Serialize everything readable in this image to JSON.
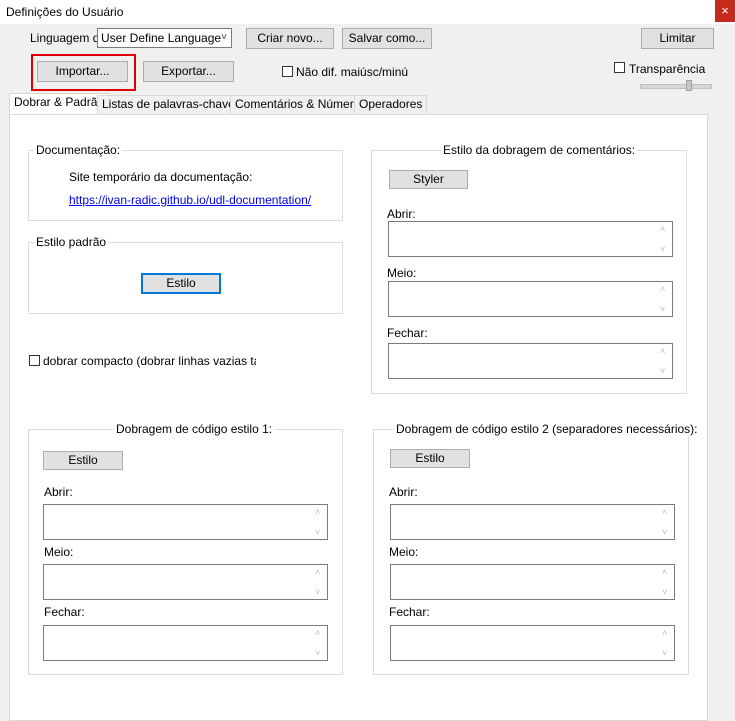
{
  "window": {
    "title": "Definições do Usuário",
    "close": "×"
  },
  "toolbar": {
    "language_label": "Linguagem do",
    "language_value": "User Define Language",
    "create_new": "Criar novo...",
    "save_as": "Salvar como...",
    "dock": "Limitar",
    "import": "Importar...",
    "export": "Exportar...",
    "ignore_case": "Não dif. maiúsc/minú",
    "transparency": "Transparência"
  },
  "tabs": [
    {
      "label": "Dobrar & Padrão",
      "active": true
    },
    {
      "label": "Listas de palavras-chave",
      "active": false
    },
    {
      "label": "Comentários & Números",
      "active": false
    },
    {
      "label": "Operadores",
      "active": false
    }
  ],
  "documentation": {
    "title": "Documentação:",
    "temp_site": "Site temporário da documentação:",
    "url": "https://ivan-radic.github.io/udl-documentation/"
  },
  "default_style": {
    "title": "Estilo padrão",
    "button": "Estilo"
  },
  "compact_fold": "dobrar compacto (dobrar linhas vazias tambe",
  "comment_fold": {
    "title": "Estilo da dobragem de comentários:",
    "button": "Styler",
    "open": "Abrir:",
    "middle": "Meio:",
    "close": "Fechar:"
  },
  "code_fold1": {
    "title": "Dobragem de código estilo 1:",
    "button": "Estilo",
    "open": "Abrir:",
    "middle": "Meio:",
    "close": "Fechar:"
  },
  "code_fold2": {
    "title": "Dobragem de código estilo 2 (separadores necessários):",
    "button": "Estilo",
    "open": "Abrir:",
    "middle": "Meio:",
    "close": "Fechar:"
  },
  "colors": {
    "highlight": "#e00000",
    "link": "#0000ee",
    "close_bg": "#c42b1c",
    "focus": "#0078d7"
  },
  "icons": {
    "close": "close-icon",
    "dropdown": "chevron-down-icon",
    "scroll_up": "scroll-up-icon",
    "scroll_down": "scroll-down-icon"
  }
}
